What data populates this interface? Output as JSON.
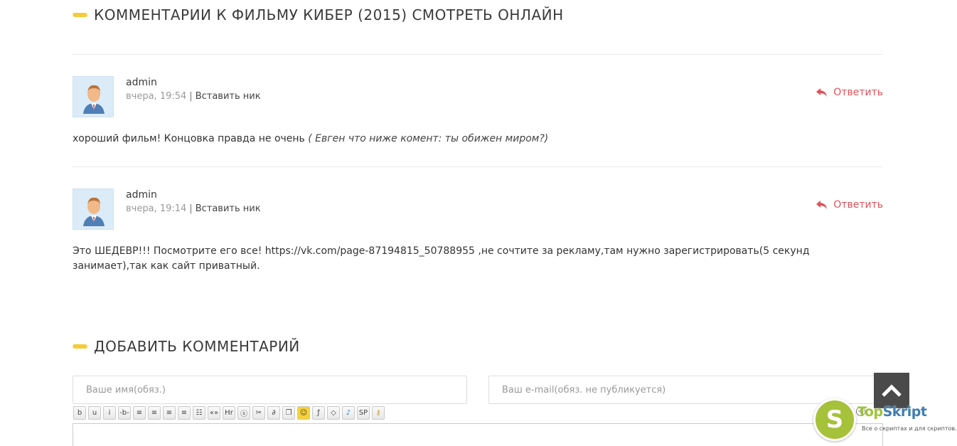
{
  "comments_title": "Комментарии к фильму Кибер (2015) смотреть онлайн",
  "comments": [
    {
      "author": "admin",
      "date": "вчера, 19:54",
      "separator": "|",
      "insert_nick": "Вставить ник",
      "reply": "Ответить",
      "text": "хороший фильм! Концовка правда не очень",
      "quote": "( Евген что ниже комент: ты обижен миром?)"
    },
    {
      "author": "admin",
      "date": "вчера, 19:14",
      "separator": "|",
      "insert_nick": "Вставить ник",
      "reply": "Ответить",
      "text": "Это ШЕДЕВР!!! Посмотрите его все! https://vk.com/page-87194815_50788955 ,не сочтите за рекламу,там нужно зарегистрировать(5 секунд занимает),так как сайт приватный."
    }
  ],
  "add_title": "Добавить комментарий",
  "form": {
    "name_placeholder": "Ваше имя(обяз.)",
    "email_placeholder": "Ваш e-mail(обяз. не публикуется)"
  },
  "toolbar": [
    {
      "name": "bold-button",
      "label": "b"
    },
    {
      "name": "underline-button",
      "label": "u"
    },
    {
      "name": "italic-button",
      "label": "i"
    },
    {
      "name": "strike-button",
      "label": "-b-"
    },
    {
      "name": "align-justify-button",
      "label": "≡"
    },
    {
      "name": "align-right-button",
      "label": "≡"
    },
    {
      "name": "align-center-button",
      "label": "≡"
    },
    {
      "name": "align-left-button",
      "label": "≡"
    },
    {
      "name": "list-button",
      "label": "☷"
    },
    {
      "name": "quote-button",
      "label": "«»"
    },
    {
      "name": "hr-button",
      "label": "Hr"
    },
    {
      "name": "spoiler-button",
      "label": "ⓢ"
    },
    {
      "name": "tools-button",
      "label": "✂"
    },
    {
      "name": "link-button",
      "label": "∂"
    },
    {
      "name": "copy-button",
      "label": "❐"
    },
    {
      "name": "smiley-button",
      "label": "☺"
    },
    {
      "name": "flash-button",
      "label": "ƒ"
    },
    {
      "name": "eraser-button",
      "label": "◇"
    },
    {
      "name": "audio-button",
      "label": "♪"
    },
    {
      "name": "sp-button",
      "label": "SP"
    },
    {
      "name": "key-button",
      "label": "⚷"
    }
  ],
  "watermark": {
    "letter": "S",
    "brand_a": "Top",
    "brand_b": "Skript",
    "tagline": "Все о скриптах и для скриптов..."
  },
  "colors": {
    "accent_yellow": "#f4cc3a",
    "reply_red": "#e0515a",
    "scroll_bg": "#4a4a4a"
  }
}
